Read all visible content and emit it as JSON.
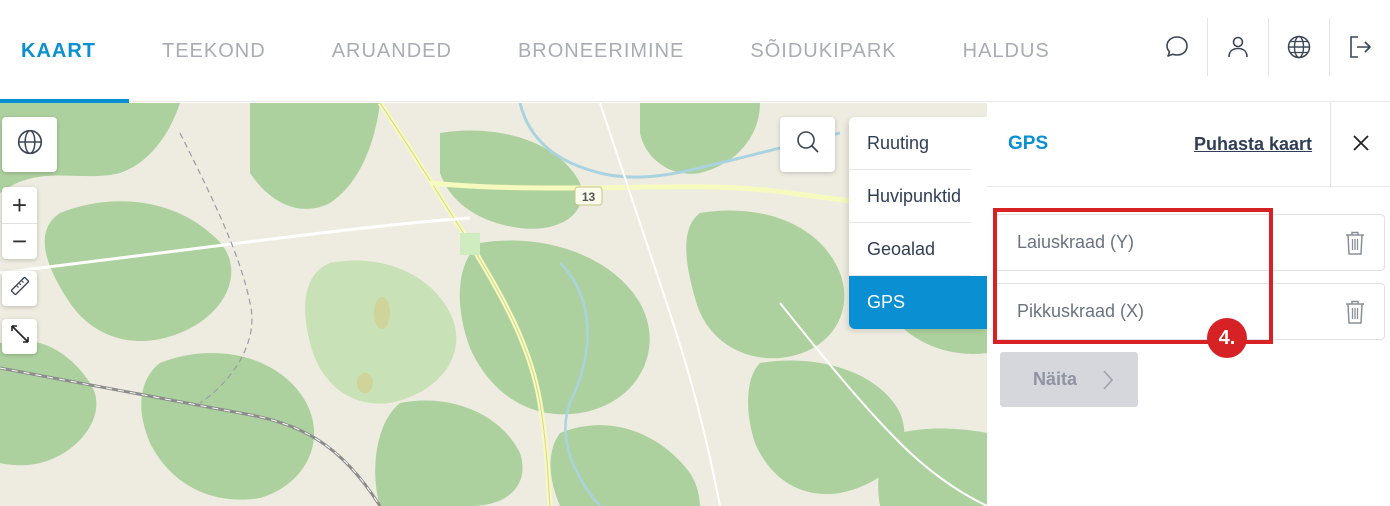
{
  "nav": {
    "items": [
      {
        "label": "KAART",
        "active": true
      },
      {
        "label": "TEEKOND"
      },
      {
        "label": "ARUANDED"
      },
      {
        "label": "BRONEERIMINE"
      },
      {
        "label": "SÕIDUKIPARK"
      },
      {
        "label": "HALDUS"
      }
    ],
    "icons": [
      "chat-icon",
      "user-icon",
      "globe-icon",
      "logout-icon"
    ]
  },
  "map": {
    "road_label": "13",
    "controls": {
      "zoom_in": "+",
      "zoom_out": "−"
    },
    "icons": [
      "globe-icon",
      "ruler-icon",
      "expand-icon",
      "search-icon"
    ]
  },
  "tabs": {
    "items": [
      {
        "label": "Ruuting"
      },
      {
        "label": "Huvipunktid"
      },
      {
        "label": "Geoalad"
      },
      {
        "label": "GPS",
        "active": true
      }
    ]
  },
  "panel": {
    "title": "GPS",
    "clear_link": "Puhasta kaart",
    "latitude_placeholder": "Laiuskraad (Y)",
    "longitude_placeholder": "Pikkuskraad (X)",
    "show_button": "Näita"
  },
  "annotation": {
    "step": "4."
  },
  "colors": {
    "accent": "#0a8fd2",
    "highlight": "#d62125",
    "text_dark": "#2f3e55",
    "nav_inactive": "#a9adb3",
    "button_disabled": "#d5d7dd"
  }
}
